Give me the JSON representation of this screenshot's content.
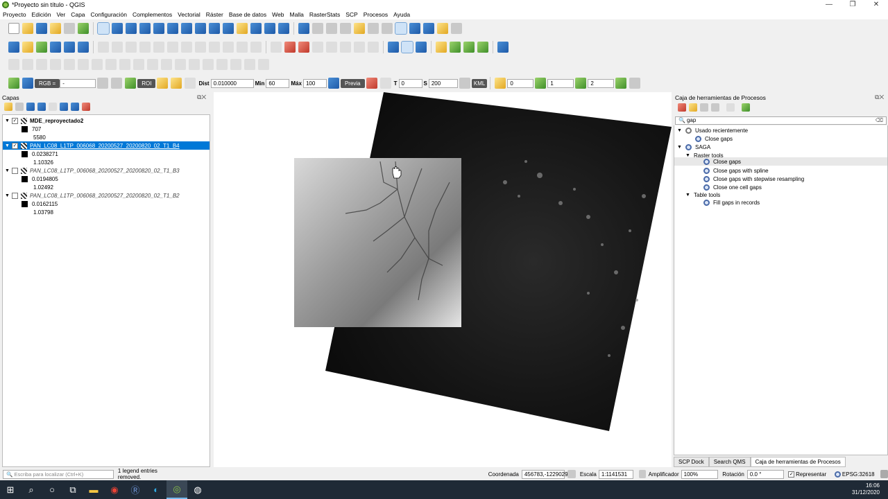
{
  "window": {
    "title": "*Proyecto sin título - QGIS",
    "minimize": "—",
    "maximize": "❐",
    "close": "✕"
  },
  "menu": [
    "Proyecto",
    "Edición",
    "Ver",
    "Capa",
    "Configuración",
    "Complementos",
    "Vectorial",
    "Ráster",
    "Base de datos",
    "Web",
    "Malla",
    "RasterStats",
    "SCP",
    "Procesos",
    "Ayuda"
  ],
  "scp_toolbar": {
    "rgb_label": "RGB =",
    "rgb_value": "-",
    "roi_label": "ROI",
    "dist_label": "Dist",
    "dist_value": "0.010000",
    "min_label": "Min",
    "min_value": "60",
    "max_label": "Máx",
    "max_value": "100",
    "preview_label": "Previa",
    "t_label": "T",
    "t_value": "0",
    "s_label": "S",
    "s_value": "200",
    "kml_label": "KML",
    "band_value1": "0",
    "band_value2": "1",
    "band_value3": "2"
  },
  "layers_panel": {
    "title": "Capas",
    "layers": [
      {
        "name": "MDE_reproyectado2",
        "checked": true,
        "selected": false,
        "bold": true,
        "italic": false,
        "min": "707",
        "max": "5580"
      },
      {
        "name": "PAN_LC08_L1TP_006068_20200527_20200820_02_T1_B4",
        "checked": true,
        "selected": true,
        "bold": false,
        "italic": false,
        "min": "0.0238271",
        "max": "1.10326"
      },
      {
        "name": "PAN_LC08_L1TP_006068_20200527_20200820_02_T1_B3",
        "checked": false,
        "selected": false,
        "bold": false,
        "italic": true,
        "min": "0.0194805",
        "max": "1.02492"
      },
      {
        "name": "PAN_LC08_L1TP_006068_20200527_20200820_02_T1_B2",
        "checked": false,
        "selected": false,
        "bold": false,
        "italic": true,
        "min": "0.0162115",
        "max": "1.03798"
      }
    ]
  },
  "toolbox": {
    "title": "Caja de herramientas de Procesos",
    "search_value": "gap",
    "recent_label": "Usado recientemente",
    "recent_items": [
      "Close gaps"
    ],
    "provider": "SAGA",
    "groups": [
      {
        "label": "Raster tools",
        "items": [
          "Close gaps",
          "Close gaps with spline",
          "Close gaps with stepwise resampling",
          "Close one cell gaps"
        ]
      },
      {
        "label": "Table tools",
        "items": [
          "Fill gaps in records"
        ]
      }
    ],
    "highlighted_item": "Close gaps"
  },
  "bottom_tabs": [
    "SCP Dock",
    "Search QMS",
    "Caja de herramientas de Procesos"
  ],
  "statusbar": {
    "locator_placeholder": "Escriba para localizar (Ctrl+K)",
    "message": "1 legend entries removed.",
    "coord_label": "Coordenada",
    "coord_value": "456783,-1229029",
    "scale_label": "Escala",
    "scale_value": "1:1141531",
    "magnifier_label": "Amplificador",
    "magnifier_value": "100%",
    "rotation_label": "Rotación",
    "rotation_value": "0.0 °",
    "render_label": "Representar",
    "crs": "EPSG:32618"
  },
  "taskbar": {
    "time": "16:06",
    "date": "31/12/2020"
  },
  "colors": {
    "selection": "#0078d7",
    "taskbar": "#1f2a36"
  }
}
